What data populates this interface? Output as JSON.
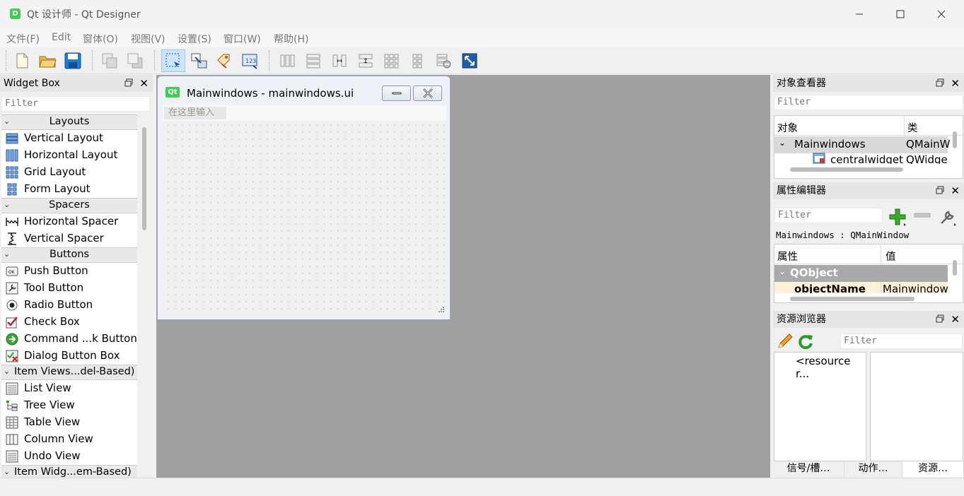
{
  "window": {
    "title": "Qt 设计师 - Qt Designer",
    "app_icon_letter": "D"
  },
  "menu": [
    "文件(F)",
    "Edit",
    "窗体(O)",
    "视图(V)",
    "设置(S)",
    "窗口(W)",
    "帮助(H)"
  ],
  "toolbar": {
    "icons": [
      "new-file-icon",
      "open-folder-icon",
      "save-icon",
      "send-to-back-icon",
      "bring-to-front-icon",
      "edit-widgets-icon",
      "edit-signals-slots-icon",
      "edit-buddies-icon",
      "edit-tab-order-icon",
      "layout-horizontal-icon",
      "layout-vertical-icon",
      "layout-horizontal-splitter-icon",
      "layout-vertical-splitter-icon",
      "layout-grid-icon",
      "layout-form-icon",
      "break-layout-icon",
      "adjust-size-icon"
    ]
  },
  "widget_box": {
    "title": "Widget Box",
    "filter_placeholder": "Filter",
    "categories": [
      {
        "label": "Layouts",
        "items": [
          "Vertical Layout",
          "Horizontal Layout",
          "Grid Layout",
          "Form Layout"
        ]
      },
      {
        "label": "Spacers",
        "items": [
          "Horizontal Spacer",
          "Vertical Spacer"
        ]
      },
      {
        "label": "Buttons",
        "items": [
          "Push Button",
          "Tool Button",
          "Radio Button",
          "Check Box",
          "Command ...k Button",
          "Dialog Button Box"
        ]
      },
      {
        "label": "Item Views...del-Based)",
        "items": [
          "List View",
          "Tree View",
          "Table View",
          "Column View",
          "Undo View"
        ]
      },
      {
        "label": "Item Widg...em-Based)",
        "items": []
      }
    ]
  },
  "form": {
    "title": "Mainwindows - mainwindows.ui",
    "qt_badge": "Qt",
    "menu_placeholder": "在这里输入"
  },
  "object_inspector": {
    "title": "对象查看器",
    "filter_placeholder": "Filter",
    "col_object": "对象",
    "col_class": "类",
    "rows": [
      {
        "name": "Mainwindows",
        "class": "QMainW"
      },
      {
        "name": "centralwidget",
        "class": "QWidge"
      }
    ]
  },
  "property_editor": {
    "title": "属性编辑器",
    "filter_placeholder": "Filter",
    "context": "Mainwindows : QMainWindow",
    "col_property": "属性",
    "col_value": "值",
    "group": "QObject",
    "row": {
      "name": "objectName",
      "value": "Mainwindow"
    }
  },
  "resource_browser": {
    "title": "资源浏览器",
    "filter_placeholder": "Filter",
    "root": "<resource r..."
  },
  "bottom_tabs": [
    "信号/槽…",
    "动作…",
    "资源…"
  ]
}
